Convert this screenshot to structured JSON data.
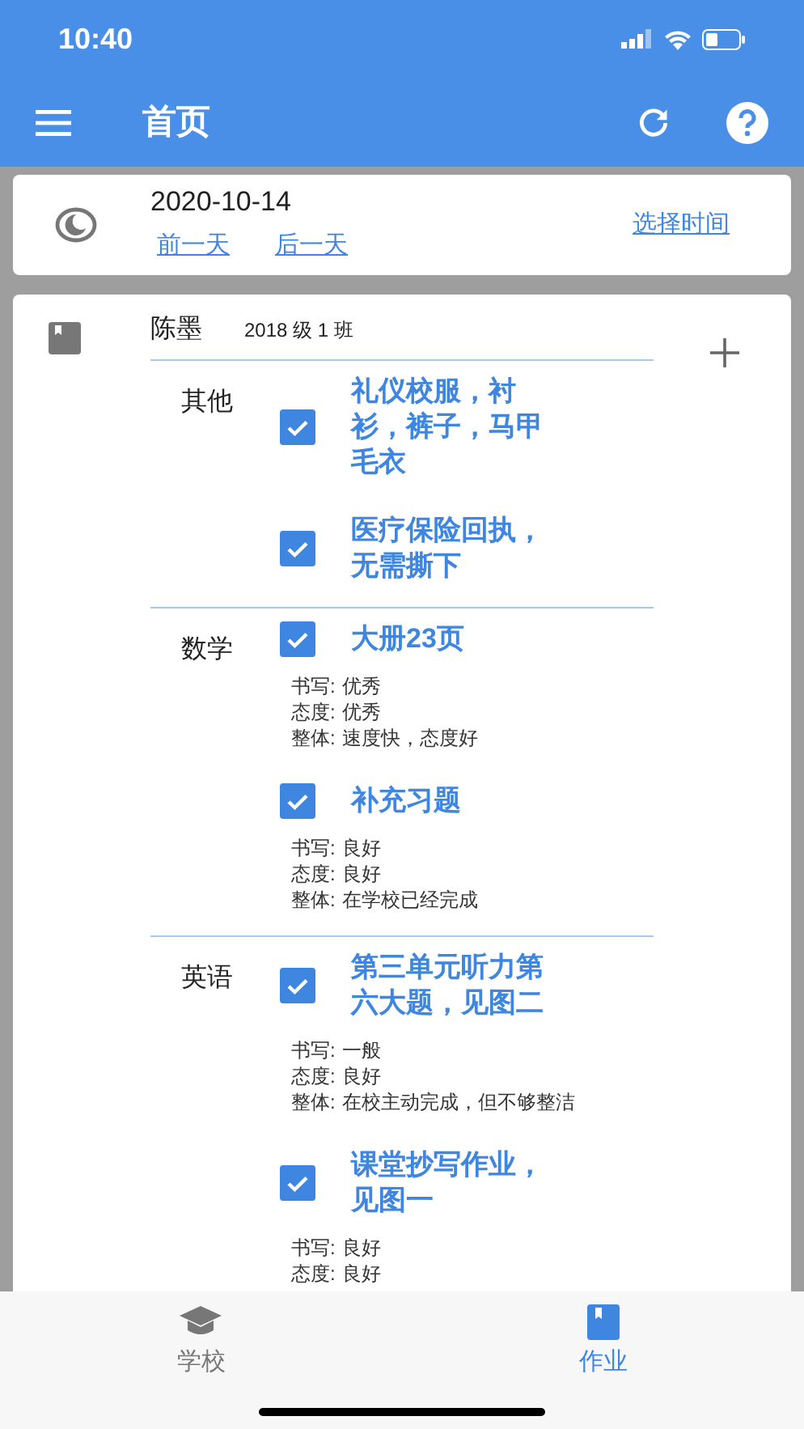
{
  "status_bar": {
    "time": "10:40"
  },
  "header": {
    "title": "首页"
  },
  "date_card": {
    "date": "2020-10-14",
    "prev_link": "前一天",
    "next_link": "后一天",
    "pick_link": "选择时间"
  },
  "student": {
    "name": "陈墨",
    "class": "2018 级 1 班",
    "subjects": [
      {
        "name": "其他",
        "items": [
          {
            "title": "礼仪校服，衬衫，裤子，马甲毛衣",
            "checked": true
          },
          {
            "title": "医疗保险回执，无需撕下",
            "checked": true
          }
        ]
      },
      {
        "name": "数学",
        "items": [
          {
            "title": "大册23页",
            "checked": true,
            "evaluations": [
              {
                "label": "书写:",
                "value": "优秀"
              },
              {
                "label": "态度:",
                "value": "优秀"
              },
              {
                "label": "整体:",
                "value": "速度快，态度好"
              }
            ]
          },
          {
            "title": "补充习题",
            "checked": true,
            "evaluations": [
              {
                "label": "书写:",
                "value": "良好"
              },
              {
                "label": "态度:",
                "value": "良好"
              },
              {
                "label": "整体:",
                "value": "在学校已经完成"
              }
            ]
          }
        ]
      },
      {
        "name": "英语",
        "items": [
          {
            "title": "第三单元听力第六大题，见图二",
            "checked": true,
            "evaluations": [
              {
                "label": "书写:",
                "value": "一般"
              },
              {
                "label": "态度:",
                "value": "良好"
              },
              {
                "label": "整体:",
                "value": "在校主动完成，但不够整洁"
              }
            ]
          },
          {
            "title": "课堂抄写作业，见图一",
            "checked": true,
            "evaluations": [
              {
                "label": "书写:",
                "value": "良好"
              },
              {
                "label": "态度:",
                "value": "良好"
              }
            ]
          }
        ]
      }
    ]
  },
  "tabs": [
    {
      "label": "学校",
      "kind": "school",
      "selected": false
    },
    {
      "label": "作业",
      "kind": "homework",
      "selected": true
    }
  ]
}
